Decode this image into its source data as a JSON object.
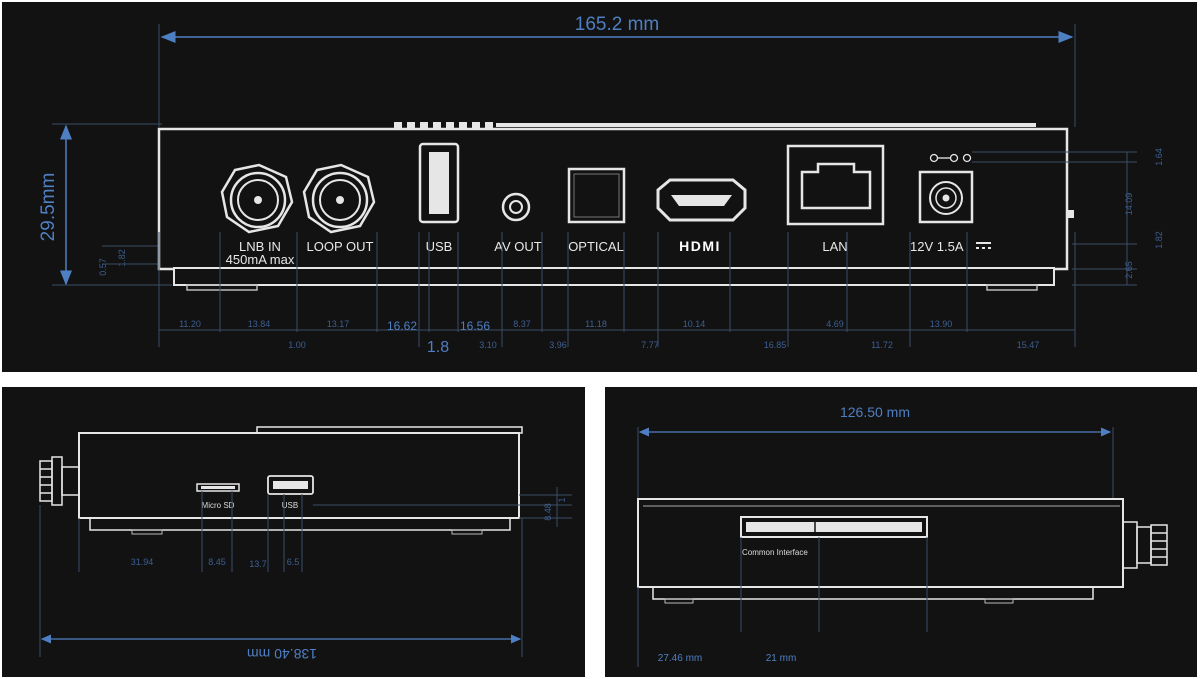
{
  "front": {
    "width_label": "165.2 mm",
    "height_label": "29.5mm",
    "port_labels": {
      "lnb": "LNB IN",
      "lnb_sub": "450mA max",
      "loop": "LOOP OUT",
      "usb": "USB",
      "av": "AV OUT",
      "optical": "OPTICAL",
      "hdmi": "HDMI",
      "lan": "LAN",
      "power": "12V 1.5A"
    },
    "bottom_dims_row1": [
      "11.20",
      "13.84",
      "13.17",
      "16.62",
      "16.56",
      "8.37",
      "11.18",
      "10.14",
      "4.69",
      "13.90"
    ],
    "bottom_dims_row2": [
      "1.00",
      "1.8",
      "3.10",
      "3.96",
      "7.77",
      "16.85",
      "11.72",
      "15.47"
    ],
    "right_dims": [
      "1.64",
      "14.09",
      "1.82",
      "2.65"
    ],
    "left_dims": [
      "1.82",
      "0.57"
    ]
  },
  "side": {
    "length_label": "138.40 mm",
    "micro_sd_label": "Micro SD",
    "usb_label": "USB",
    "bottom_dims": [
      "31.94",
      "8.45",
      "13.7",
      "6.5"
    ],
    "right_dims": [
      "8.48",
      "1"
    ]
  },
  "rear": {
    "width_label": "126.50 mm",
    "ci_label": "Common Interface",
    "dim_a": "27.46 mm",
    "dim_b": "21 mm"
  }
}
